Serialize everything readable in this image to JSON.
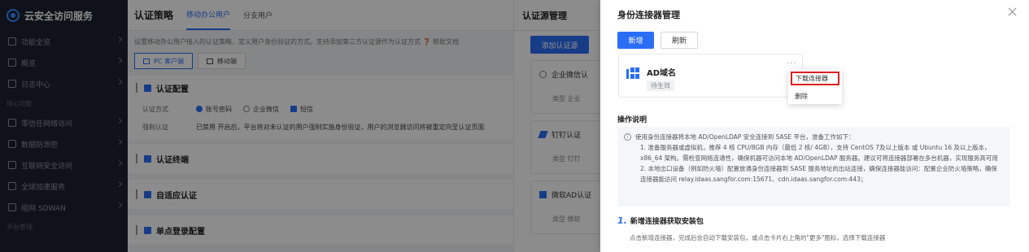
{
  "sidebar": {
    "brand": "云安全访问服务",
    "items": [
      {
        "label": "功能全览",
        "icon": "grid-icon"
      },
      {
        "label": "概览",
        "icon": "dashboard-icon"
      },
      {
        "label": "日志中心",
        "icon": "log-icon"
      }
    ],
    "section_core": "核心功能",
    "core_items": [
      {
        "label": "零信任网络访问",
        "icon": "shield-icon"
      },
      {
        "label": "数据防泄密",
        "icon": "data-icon"
      },
      {
        "label": "互联网安全访问",
        "icon": "globe-icon"
      },
      {
        "label": "全球加速服务",
        "icon": "speed-icon"
      },
      {
        "label": "组网 SDWAN",
        "icon": "network-icon"
      }
    ],
    "section_platform": "平台管理"
  },
  "policy": {
    "title": "认证策略",
    "tabs": [
      "移动办公用户",
      "分支用户"
    ],
    "description": "设置移动办公用户接入的认证策略，定义用户身份验证的方式。支持添加第三方认证源作为认证方式 ❓ 帮助文档",
    "client_tabs": [
      "PC 客户端",
      "移动端"
    ],
    "sections": {
      "auth_config": "认证配置",
      "auth_terminal": "认证终端",
      "adaptive": "自适应认证",
      "sso": "单点登录配置"
    },
    "auth_method_label": "认证方式",
    "methods": [
      "账号密码",
      "企业微信",
      "短信"
    ],
    "force_label": "强制认证",
    "force_value": "已禁用  开启后，平台将对未认证的用户强制实施身份验证，用户的浏览器访问将被重定向至认证页面"
  },
  "source": {
    "title": "认证源管理",
    "add_button": "添加认证源",
    "cards": [
      {
        "name": "企业微信认",
        "sub": "类型  企业"
      },
      {
        "name": "钉钉认证",
        "sub": "类型  钉钉"
      },
      {
        "name": "微软AD认证",
        "sub": "类型  微软"
      }
    ]
  },
  "drawer": {
    "title": "身份连接器管理",
    "new_button": "新增",
    "refresh_button": "刷新",
    "connector": {
      "name": "AD域名",
      "status": "待生效"
    },
    "menu": {
      "download": "下载连接器",
      "delete": "删除"
    },
    "op_title": "操作说明",
    "op_intro": "使用身份连接器将本地 AD/OpenLDAP 安全连接到 SASE 平台，准备工作如下：",
    "op_steps": [
      "1. 准备服务器或虚拟机，推荐 4 核 CPU/8GB 内存（最低 2 核/ 4GB），支持 CentOS 7及以上版本 或 Ubuntu 16 及以上版本，x86_64 架构。需检查网络连通性，确保机器可访问本地 AD/OpenLDAP 服务器。建议可将连接器部署在多台机器，实现服务高可用",
      "2. 本地出口设备（例如防火墙）配置放通身份连接器到 SASE 服务地址的出站连接，确保连接器能访问：配置企业防火墙策略，确保连接器能访问 relay.idaas.sangfor.com:15671、cdn.idaas.sangfor.com:443；"
    ],
    "step1_num": "1.",
    "step1_title": "新增连接器获取安装包",
    "step1_desc": "点击新增连接器，完成后会自动下载安装包，或点击卡片右上角的\"更多\"图标，选择下载连接器"
  },
  "colors": {
    "accent": "#2b6ef6",
    "sidebar": "#1c2230",
    "highlight": "#e02020"
  }
}
